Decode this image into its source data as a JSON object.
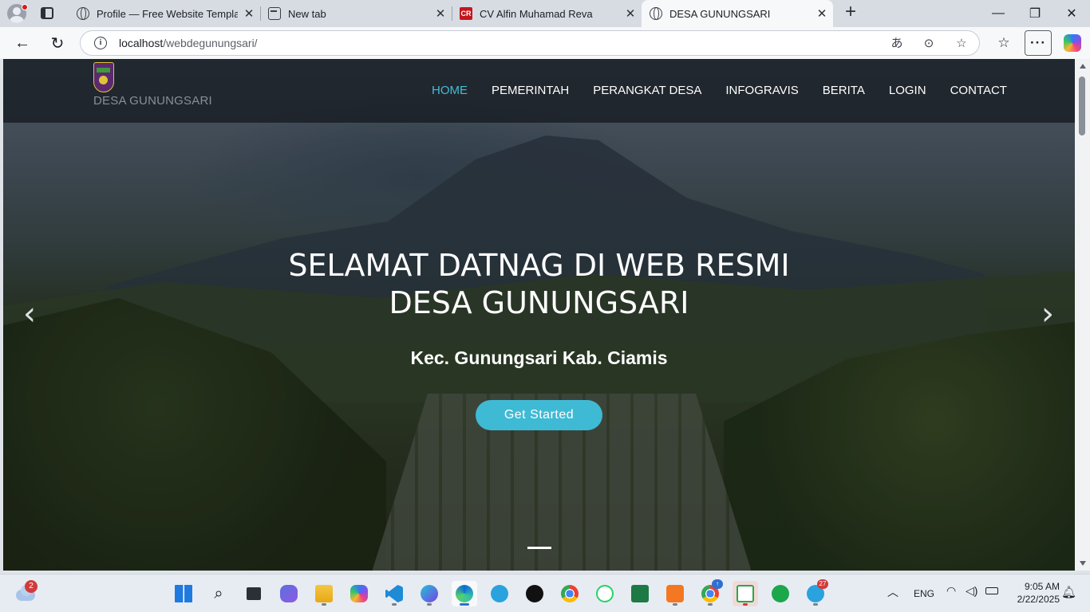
{
  "browser": {
    "tabs": [
      {
        "title": "Profile — Free Website Template",
        "icon": "globe-icon"
      },
      {
        "title": "New tab",
        "icon": "new-tab-page-icon"
      },
      {
        "title": "CV Alfin Muhamad Reva",
        "icon": "cv-favicon",
        "favicon_text": "CR"
      },
      {
        "title": "DESA GUNUNGSARI",
        "icon": "globe-icon",
        "active": true
      }
    ],
    "address": {
      "host": "localhost",
      "path": "/webdegunungsari/"
    }
  },
  "site": {
    "brand": "DESA GUNUNGSARI",
    "nav": [
      {
        "label": "HOME",
        "active": true
      },
      {
        "label": "PEMERINTAH"
      },
      {
        "label": "PERANGKAT DESA"
      },
      {
        "label": "INFOGRAVIS"
      },
      {
        "label": "BERITA"
      },
      {
        "label": "LOGIN"
      },
      {
        "label": "CONTACT"
      }
    ],
    "hero": {
      "title_line1": "SELAMAT DATNAG DI WEB RESMI",
      "title_line2": "DESA GUNUNGSARI",
      "subtitle": "Kec. Gunungsari Kab. Ciamis",
      "cta": "Get Started",
      "prev_icon": "chevron-left-icon",
      "next_icon": "chevron-right-icon"
    },
    "colors": {
      "accent": "#43bcd8",
      "button": "#3fbad4"
    }
  },
  "taskbar": {
    "weather_badge": "2",
    "apps": [
      {
        "name": "start"
      },
      {
        "name": "search"
      },
      {
        "name": "task-view"
      },
      {
        "name": "meet"
      },
      {
        "name": "file-explorer"
      },
      {
        "name": "copilot"
      },
      {
        "name": "vscode"
      },
      {
        "name": "canva"
      },
      {
        "name": "edge",
        "active": true
      },
      {
        "name": "telegram-desktop"
      },
      {
        "name": "tiktok"
      },
      {
        "name": "chrome"
      },
      {
        "name": "whatsapp-web"
      },
      {
        "name": "excel"
      },
      {
        "name": "xampp"
      },
      {
        "name": "chrome-profile",
        "badge": "↑"
      },
      {
        "name": "terminal-green"
      },
      {
        "name": "whatsapp"
      },
      {
        "name": "telegram",
        "badge": "27"
      }
    ],
    "language": "ENG",
    "time": "9:05 AM",
    "date": "2/22/2025"
  }
}
